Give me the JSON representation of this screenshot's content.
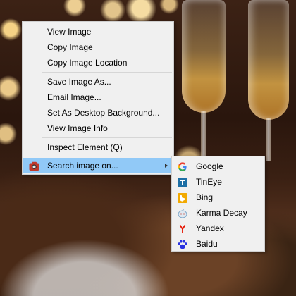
{
  "context_menu": {
    "items": [
      {
        "label": "View Image"
      },
      {
        "label": "Copy Image"
      },
      {
        "label": "Copy Image Location"
      },
      {
        "label": "Save Image As..."
      },
      {
        "label": "Email Image..."
      },
      {
        "label": "Set As Desktop Background..."
      },
      {
        "label": "View Image Info"
      },
      {
        "label": "Inspect Element (Q)"
      },
      {
        "label": "Search image on...",
        "icon": "camera-icon"
      }
    ],
    "highlight_color": "#91c9f7"
  },
  "submenu": {
    "items": [
      {
        "label": "Google",
        "icon": "google-icon",
        "color": "#4285f4"
      },
      {
        "label": "TinEye",
        "icon": "tineye-icon",
        "color": "#1d6fa5"
      },
      {
        "label": "Bing",
        "icon": "bing-icon",
        "color": "#f2a900"
      },
      {
        "label": "Karma Decay",
        "icon": "karma-decay-icon",
        "color": "#7fa7c9"
      },
      {
        "label": "Yandex",
        "icon": "yandex-icon",
        "color": "#e61400"
      },
      {
        "label": "Baidu",
        "icon": "baidu-icon",
        "color": "#2932e1"
      }
    ]
  }
}
